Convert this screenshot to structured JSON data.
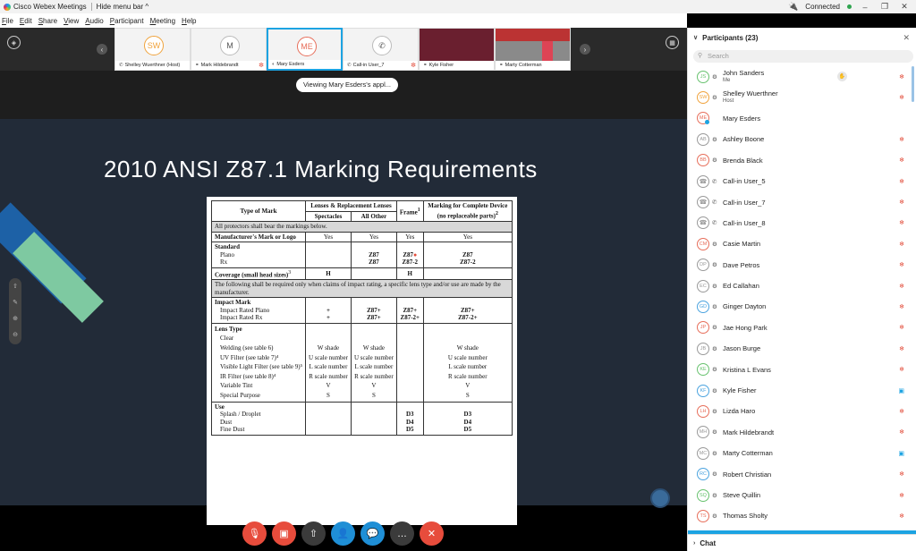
{
  "titlebar": {
    "app_title": "Cisco Webex Meetings",
    "hide_menu": "Hide menu bar",
    "hide_menu_caret": "^",
    "status": "Connected",
    "min": "–",
    "restore": "❐",
    "close": "✕"
  },
  "menu": [
    {
      "u": "F",
      "rest": "ile"
    },
    {
      "u": "E",
      "rest": "dit"
    },
    {
      "u": "S",
      "rest": "hare"
    },
    {
      "u": "V",
      "rest": "iew"
    },
    {
      "u": "A",
      "rest": "udio"
    },
    {
      "u": "P",
      "rest": "articipant"
    },
    {
      "u": "M",
      "rest": "eeting"
    },
    {
      "u": "H",
      "rest": "elp"
    }
  ],
  "strip": {
    "thumbs": [
      {
        "initials": "SW",
        "label": "Shelley Wuerthner (Host)"
      },
      {
        "initials": "M",
        "label": "Mark Hildebrandt"
      },
      {
        "initials": "ME",
        "label": "Mary Esders"
      },
      {
        "initials": "",
        "label": "Call-in User_7"
      },
      {
        "initials": "",
        "label": "Kyle Fisher"
      },
      {
        "initials": "",
        "label": "Marty Cotterman"
      }
    ],
    "viewing": "Viewing Mary Esders's appl..."
  },
  "slide": {
    "title": "2010 ANSI Z87.1 Marking Requirements",
    "table": {
      "h_type": "Type of Mark",
      "h_lenses": "Lenses & Replacement Lenses",
      "h_spectacles": "Spectacles",
      "h_allother": "All Other",
      "h_frame": "Frame",
      "h_frame_sup": "1",
      "h_complete": "Marking for Complete Device (no replaceable parts)",
      "h_complete_sup": "2",
      "all_protectors": "All protectors shall bear the markings below.",
      "mfr_label": "Manufacturer's Mark or Logo",
      "mfr_vals": [
        "Yes",
        "Yes",
        "Yes",
        "Yes"
      ],
      "standard": "Standard",
      "plano": "Plano",
      "rx": "Rx",
      "std_allother": [
        "Z87",
        "Z87"
      ],
      "std_frame": [
        "Z87",
        "Z87-2"
      ],
      "std_complete": [
        "Z87",
        "Z87-2"
      ],
      "coverage": "Coverage (small head sizes)",
      "coverage_sup": "3",
      "cov_h": "H",
      "following": "The following shall be required only when claims of impact rating, a specific lens type and/or use are made by the manufacturer.",
      "impact": "Impact Mark",
      "impact_plano": "Impact Rated Plano",
      "impact_rx": "Impact Rated Rx",
      "imp_spect": [
        "+",
        "+"
      ],
      "imp_allother": [
        "Z87+",
        "Z87+"
      ],
      "imp_frame": [
        "Z87+",
        "Z87-2+"
      ],
      "imp_complete": [
        "Z87+",
        "Z87-2+"
      ],
      "lens_type": "Lens Type",
      "lens_items": [
        "Clear",
        "Welding (see table 6)",
        "UV Filter (see table 7)⁴",
        "Visible Light Filter (see table 9)⁵",
        "IR Filter (see table 8)⁴",
        "Variable Tint",
        "Special Purpose"
      ],
      "lens_spect": [
        "W shade",
        "U scale number",
        "L scale number",
        "R scale number",
        "V",
        "S"
      ],
      "lens_allother": [
        "W shade",
        "U scale number",
        "L scale number",
        "R scale number",
        "V",
        "S"
      ],
      "lens_complete": [
        "W shade",
        "U scale number",
        "L scale number",
        "R scale number",
        "V",
        "S"
      ],
      "use": "Use",
      "use_items": [
        "Splash / Droplet",
        "Dust",
        "Fine Dust"
      ],
      "use_frame": [
        "D3",
        "D4",
        "D5"
      ],
      "use_complete": [
        "D3",
        "D4",
        "D5"
      ]
    }
  },
  "controls": {
    "mute": "🎙",
    "video": "▣",
    "share": "⇧",
    "participants": "👤",
    "chat": "💬",
    "more": "…",
    "end": "✕"
  },
  "panel": {
    "title": "Participants (23)",
    "search_placeholder": "Search",
    "chat_label": "Chat",
    "participants": [
      {
        "initials": "JS",
        "name": "John Sanders",
        "sub": "Me",
        "state": "raise",
        "color": "#67c26e"
      },
      {
        "initials": "SW",
        "name": "Shelley Wuerthner",
        "sub": "Host",
        "state": "mute",
        "color": "#f0a33c"
      },
      {
        "initials": "ME",
        "name": "Mary Esders",
        "sub": "",
        "state": "presenter",
        "color": "#e76e5a"
      },
      {
        "initials": "AB",
        "name": "Ashley Boone",
        "sub": "",
        "state": "mute",
        "color": "#999999"
      },
      {
        "initials": "BB",
        "name": "Brenda Black",
        "sub": "",
        "state": "mute",
        "color": "#e76e5a"
      },
      {
        "initials": "",
        "name": "Call-in User_5",
        "sub": "",
        "state": "mute",
        "color": "#999999"
      },
      {
        "initials": "",
        "name": "Call-in User_7",
        "sub": "",
        "state": "mute",
        "color": "#999999"
      },
      {
        "initials": "",
        "name": "Call-in User_8",
        "sub": "",
        "state": "mute",
        "color": "#999999"
      },
      {
        "initials": "CM",
        "name": "Casie Martin",
        "sub": "",
        "state": "mute",
        "color": "#e76e5a"
      },
      {
        "initials": "DP",
        "name": "Dave Petros",
        "sub": "",
        "state": "mute",
        "color": "#999999"
      },
      {
        "initials": "EC",
        "name": "Ed Callahan",
        "sub": "",
        "state": "mute",
        "color": "#999999"
      },
      {
        "initials": "GD",
        "name": "Ginger Dayton",
        "sub": "",
        "state": "mute",
        "color": "#4aa3df"
      },
      {
        "initials": "JP",
        "name": "Jae Hong Park",
        "sub": "",
        "state": "mute",
        "color": "#e76e5a"
      },
      {
        "initials": "JB",
        "name": "Jason Burge",
        "sub": "",
        "state": "mute",
        "color": "#999999"
      },
      {
        "initials": "KE",
        "name": "Kristina L Evans",
        "sub": "",
        "state": "mute",
        "color": "#67c26e"
      },
      {
        "initials": "KF",
        "name": "Kyle Fisher",
        "sub": "",
        "state": "video",
        "color": "#4aa3df"
      },
      {
        "initials": "LH",
        "name": "Lizda Haro",
        "sub": "",
        "state": "mute",
        "color": "#e76e5a"
      },
      {
        "initials": "MH",
        "name": "Mark Hildebrandt",
        "sub": "",
        "state": "mute",
        "color": "#999999"
      },
      {
        "initials": "MC",
        "name": "Marty Cotterman",
        "sub": "",
        "state": "video",
        "color": "#999999"
      },
      {
        "initials": "RC",
        "name": "Robert Christian",
        "sub": "",
        "state": "mute",
        "color": "#4aa3df"
      },
      {
        "initials": "SQ",
        "name": "Steve Quillin",
        "sub": "",
        "state": "mute",
        "color": "#67c26e"
      },
      {
        "initials": "TS",
        "name": "Thomas Sholty",
        "sub": "",
        "state": "mute",
        "color": "#e76e5a"
      }
    ]
  }
}
